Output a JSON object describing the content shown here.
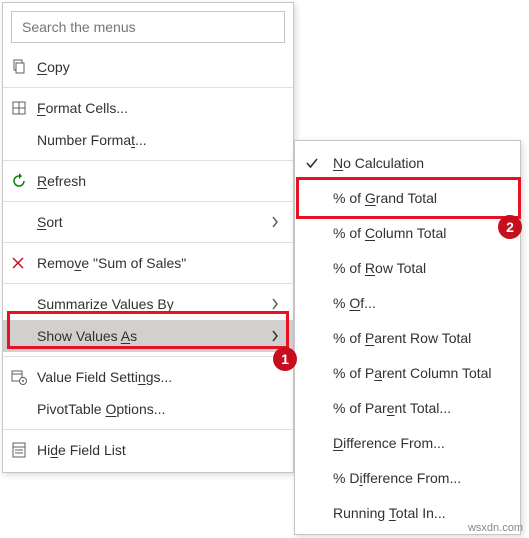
{
  "search": {
    "placeholder": "Search the menus"
  },
  "main": {
    "copy": "Copy",
    "format_cells": "Format Cells...",
    "number_format": "Number Format...",
    "refresh": "Refresh",
    "sort": "Sort",
    "remove": "Remove \"Sum of Sales\"",
    "summarize": "Summarize Values By",
    "show_values": "Show Values As",
    "value_field": "Value Field Settings...",
    "pivot_options": "PivotTable Options...",
    "hide_field": "Hide Field List"
  },
  "sub": {
    "no_calc": "No Calculation",
    "grand_total": "% of Grand Total",
    "col_total": "% of Column Total",
    "row_total": "% of Row Total",
    "of": "% Of...",
    "parent_row": "% of Parent Row Total",
    "parent_col": "% of Parent Column Total",
    "parent_total": "% of Parent Total...",
    "diff_from": "Difference From...",
    "pct_diff": "% Difference From...",
    "running": "Running Total In..."
  },
  "badges": {
    "one": "1",
    "two": "2"
  },
  "watermark": "wsxdn.com"
}
